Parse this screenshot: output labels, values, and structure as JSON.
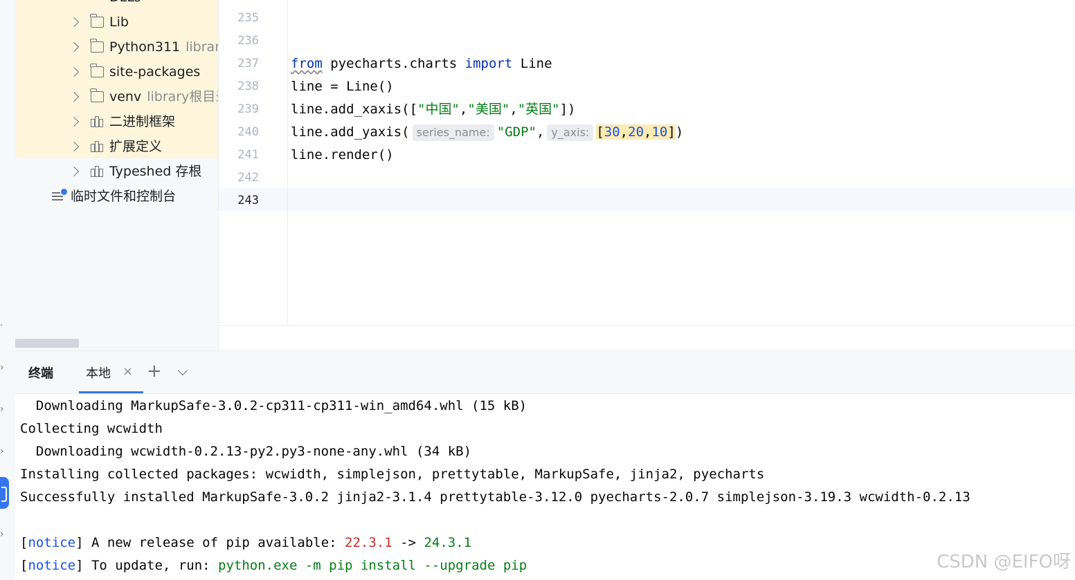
{
  "project_tree": {
    "partial_top_label": "DLLs",
    "items": [
      {
        "label": "Lib",
        "hint": "",
        "icon": "folder-icon"
      },
      {
        "label": "Python311",
        "hint": "library",
        "icon": "folder-icon"
      },
      {
        "label": "site-packages",
        "hint": "",
        "icon": "folder-icon"
      },
      {
        "label": "venv",
        "hint": "library根目录",
        "icon": "folder-icon"
      },
      {
        "label": "二进制框架",
        "hint": "",
        "icon": "library-icon"
      },
      {
        "label": "扩展定义",
        "hint": "",
        "icon": "library-icon"
      },
      {
        "label": "Typeshed 存根",
        "hint": "",
        "icon": "library-icon"
      }
    ],
    "scratches_label": "临时文件和控制台"
  },
  "editor": {
    "line_numbers": [
      "235",
      "236",
      "237",
      "238",
      "239",
      "240",
      "241",
      "242",
      "243"
    ],
    "current_line": "243",
    "code": {
      "l237_from": "from",
      "l237_module": " pyecharts.charts ",
      "l237_import": "import",
      "l237_name": " Line",
      "l238": "line = Line()",
      "l239_pre": "line.add_xaxis([",
      "l239_s1": "\"中国\"",
      "l239_c1": ",",
      "l239_s2": "\"美国\"",
      "l239_c2": ",",
      "l239_s3": "\"英国\"",
      "l239_post": "])",
      "l240_pre": "line.add_yaxis(",
      "l240_hint1": "series_name:",
      "l240_s1": "\"GDP\"",
      "l240_comma": ",",
      "l240_hint2": "y_axis:",
      "l240_lb": "[",
      "l240_n1": "30",
      "l240_c1": ",",
      "l240_n2": "20",
      "l240_c2": ",",
      "l240_n3": "10",
      "l240_rb": "]",
      "l240_post": ")",
      "l241": "line.render()"
    }
  },
  "terminal": {
    "title": "终端",
    "tab_label": "本地",
    "tab_close": "×",
    "add_label": "+",
    "lines": {
      "l1": "  Downloading MarkupSafe-3.0.2-cp311-cp311-win_amd64.whl (15 kB)",
      "l2": "Collecting wcwidth",
      "l3": "  Downloading wcwidth-0.2.13-py2.py3-none-any.whl (34 kB)",
      "l4": "Installing collected packages: wcwidth, simplejson, prettytable, MarkupSafe, jinja2, pyecharts",
      "l5": "Successfully installed MarkupSafe-3.0.2 jinja2-3.1.4 prettytable-3.12.0 pyecharts-2.0.7 simplejson-3.19.3 wcwidth-0.2.13",
      "notice1_open": "[",
      "notice1_word": "notice",
      "notice1_close": "]",
      "notice1_text": " A new release of pip available: ",
      "notice1_old": "22.3.1",
      "notice1_arrow": " -> ",
      "notice1_new": "24.3.1",
      "notice2_open": "[",
      "notice2_word": "notice",
      "notice2_close": "]",
      "notice2_text": " To update, run: ",
      "notice2_cmd": "python.exe -m pip install --upgrade pip"
    }
  },
  "watermark": "CSDN @EIFO呀",
  "colors": {
    "keyword": "#0033b3",
    "string": "#067d17",
    "number": "#1750eb",
    "accent": "#3574f0",
    "tree_highlight": "#fdf5dc"
  }
}
